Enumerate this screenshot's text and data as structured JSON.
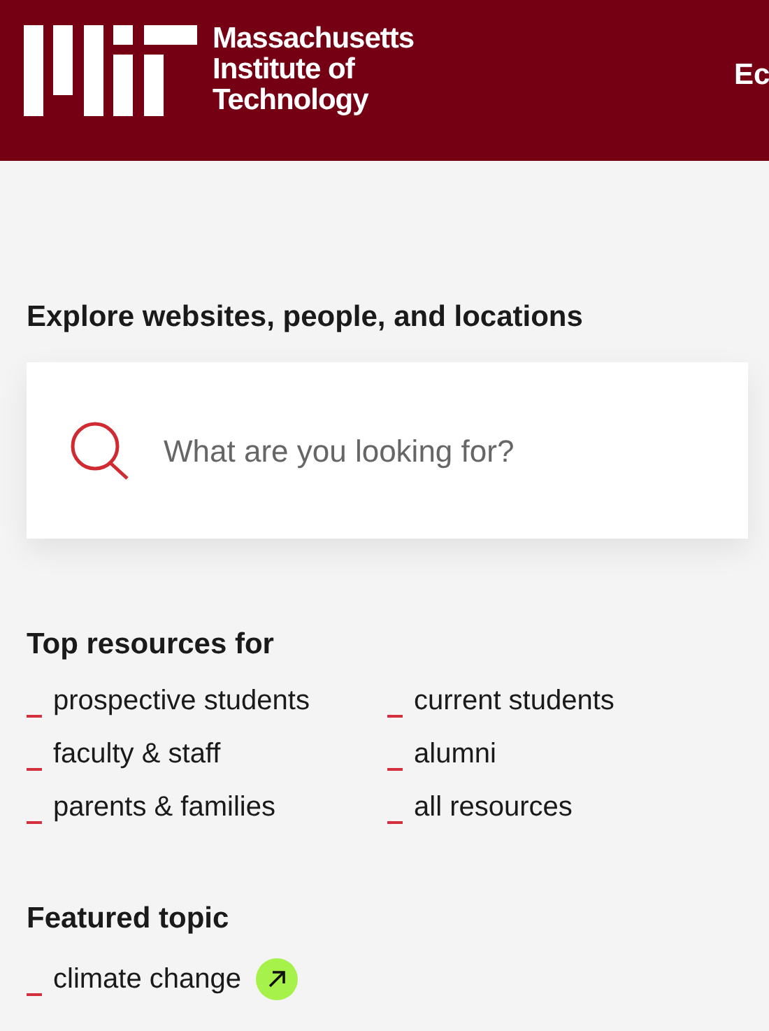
{
  "header": {
    "logo_lines": [
      "Massachusetts",
      "Institute of",
      "Technology"
    ],
    "nav_cut": "Ec"
  },
  "search": {
    "heading": "Explore websites, people, and locations",
    "placeholder": "What are you looking for?"
  },
  "resources": {
    "heading": "Top resources for",
    "items": [
      {
        "label": "prospective students"
      },
      {
        "label": "current students"
      },
      {
        "label": "faculty & staff"
      },
      {
        "label": "alumni"
      },
      {
        "label": "parents & families"
      },
      {
        "label": "all resources"
      }
    ]
  },
  "featured": {
    "heading": "Featured topic",
    "link": "climate change"
  }
}
